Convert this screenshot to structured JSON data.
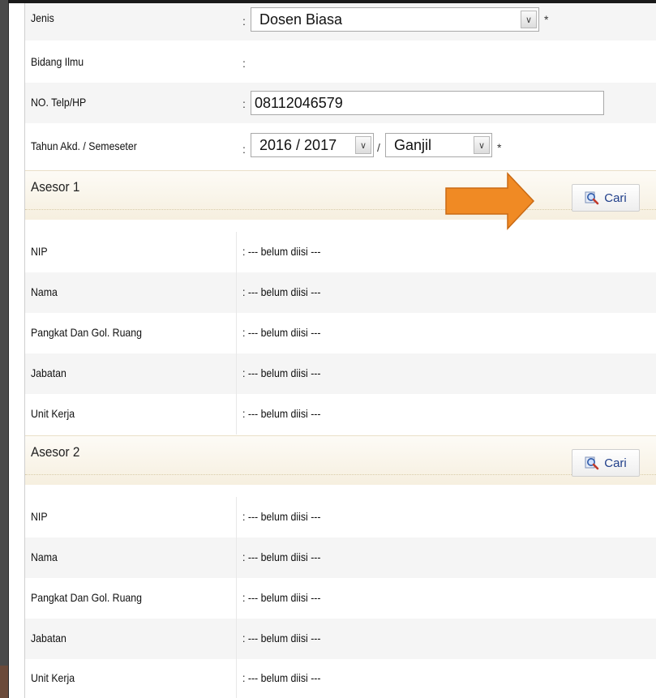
{
  "form": {
    "jenis": {
      "label": "Jenis",
      "value": "Dosen Biasa",
      "required": "*"
    },
    "bidang_ilmu": {
      "label": "Bidang Ilmu"
    },
    "telp": {
      "label": "NO. Telp/HP",
      "value": "08112046579"
    },
    "tahun": {
      "label": "Tahun Akd. / Semeseter",
      "year": "2016 / 2017",
      "slash": "/",
      "semester": "Ganjil",
      "required": "*"
    },
    "colon": ":"
  },
  "asesor1": {
    "title": "Asesor 1",
    "search_label": "Cari",
    "fields": [
      {
        "label": "NIP",
        "value": ": --- belum diisi ---"
      },
      {
        "label": "Nama",
        "value": ": --- belum diisi ---"
      },
      {
        "label": "Pangkat Dan Gol. Ruang",
        "value": ": --- belum diisi ---"
      },
      {
        "label": "Jabatan",
        "value": ": --- belum diisi ---"
      },
      {
        "label": "Unit Kerja",
        "value": ": --- belum diisi ---"
      }
    ]
  },
  "asesor2": {
    "title": "Asesor 2",
    "search_label": "Cari",
    "fields": [
      {
        "label": "NIP",
        "value": ": --- belum diisi ---"
      },
      {
        "label": "Nama",
        "value": ": --- belum diisi ---"
      },
      {
        "label": "Pangkat Dan Gol. Ruang",
        "value": ": --- belum diisi ---"
      },
      {
        "label": "Jabatan",
        "value": ": --- belum diisi ---"
      },
      {
        "label": "Unit Kerja",
        "value": ": --- belum diisi ---"
      }
    ]
  },
  "icons": {
    "search": "search-magnifier-icon",
    "dropdown": "chevron-down-icon",
    "annotation": "orange-arrow-icon"
  },
  "colors": {
    "accent_arrow": "#f08a24",
    "link": "#1f3e8a",
    "section_bg": "#f6efdf"
  }
}
